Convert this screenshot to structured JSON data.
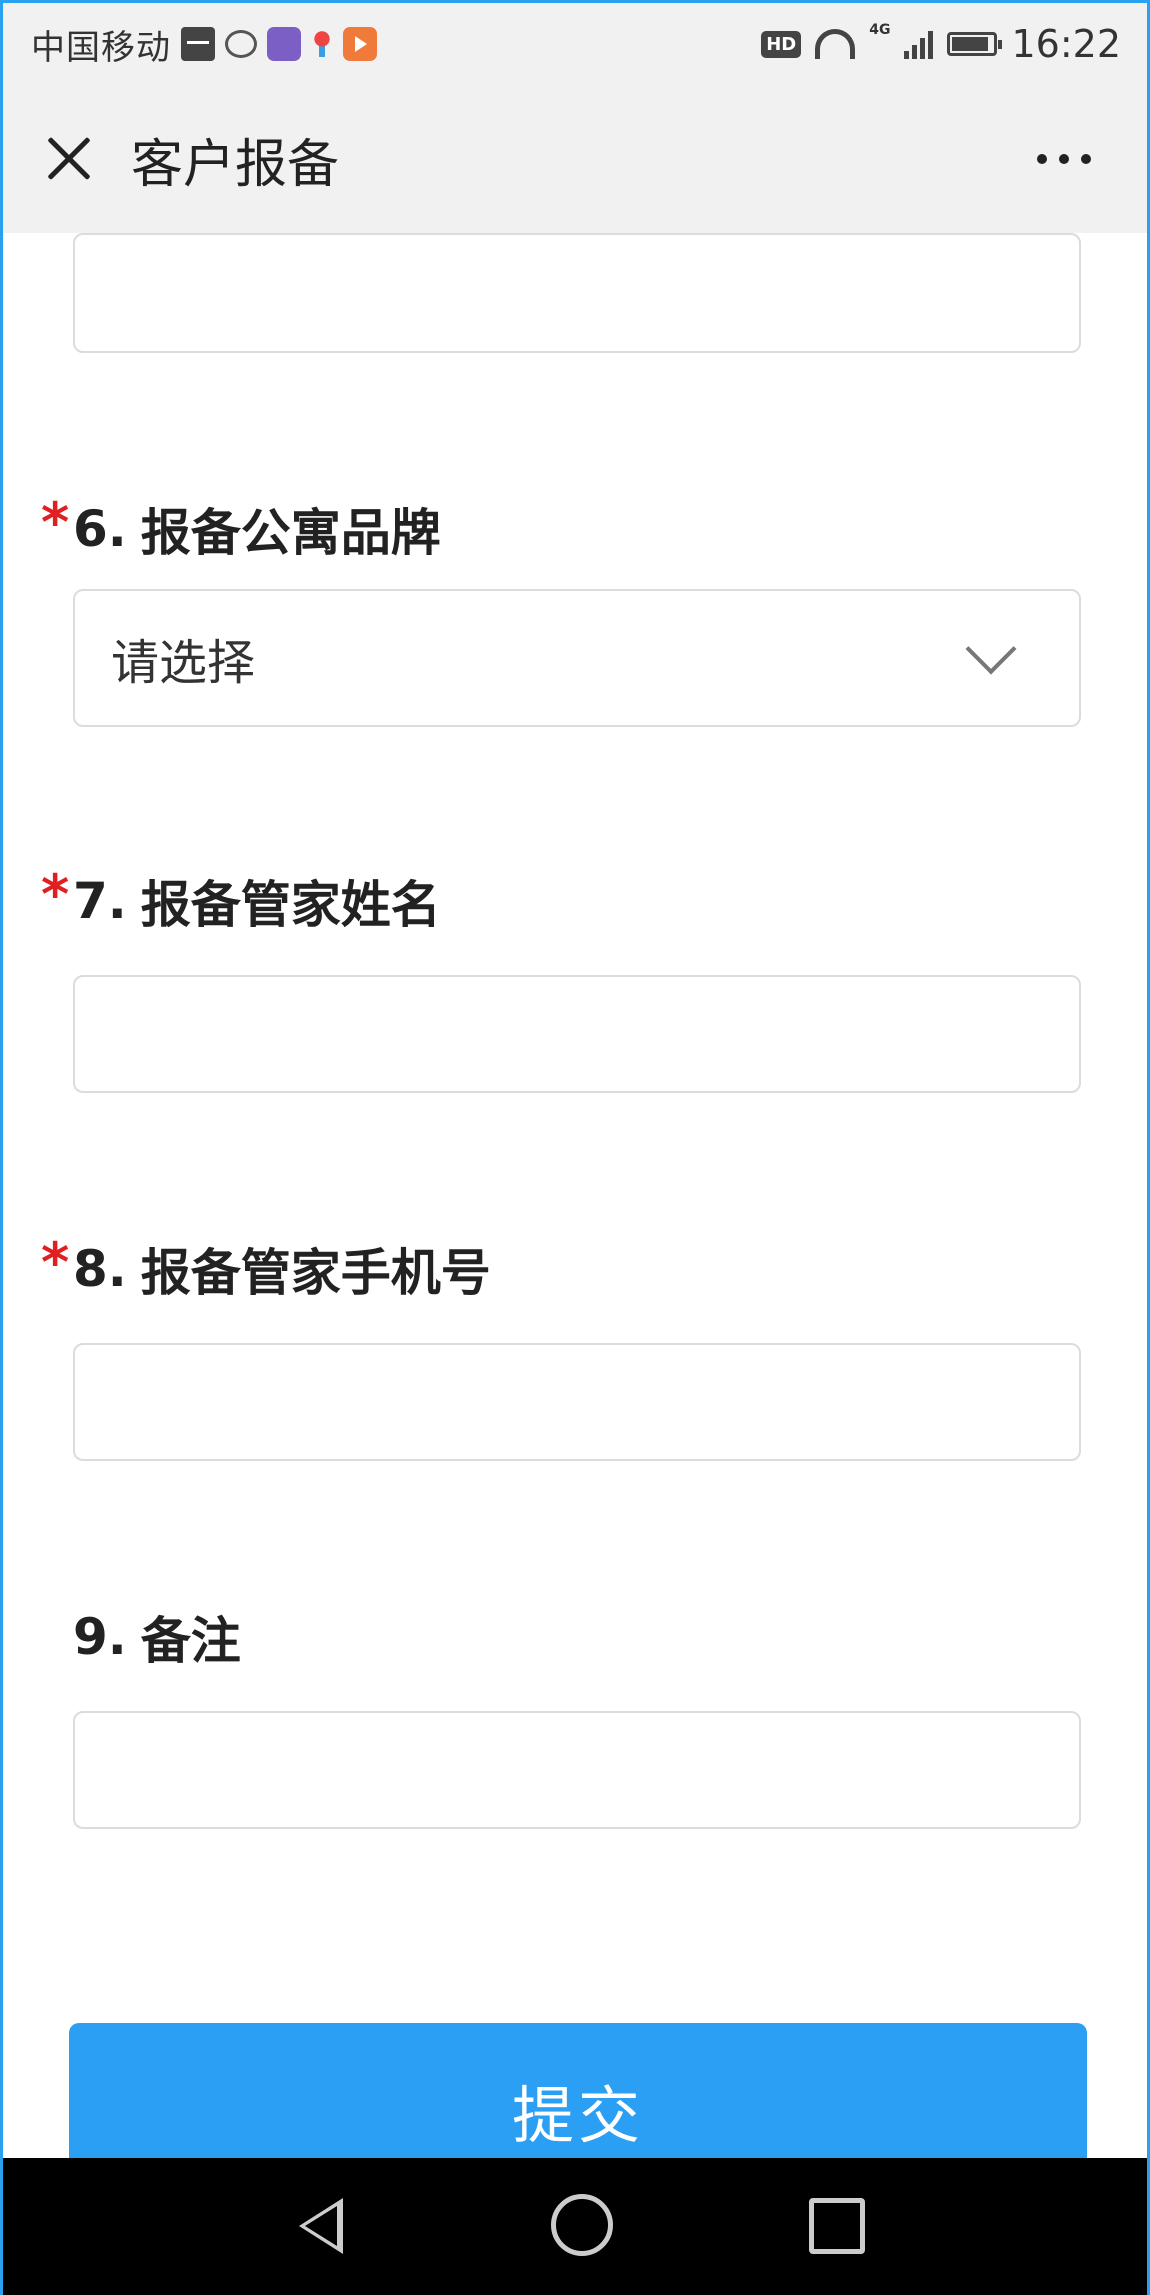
{
  "status_bar": {
    "carrier": "中国移动",
    "network": "4G",
    "hd_label": "HD",
    "time": "16:22",
    "battery_level": 0.9
  },
  "header": {
    "title": "客户报备"
  },
  "form": {
    "fields": [
      {
        "number": "6.",
        "label": "报备公寓品牌",
        "required": true,
        "type": "select",
        "placeholder": "请选择"
      },
      {
        "number": "7.",
        "label": "报备管家姓名",
        "required": true,
        "type": "text",
        "value": ""
      },
      {
        "number": "8.",
        "label": "报备管家手机号",
        "required": true,
        "type": "text",
        "value": ""
      },
      {
        "number": "9.",
        "label": "备注",
        "required": false,
        "type": "text",
        "value": ""
      }
    ],
    "required_mark": "*",
    "submit_label": "提交"
  }
}
